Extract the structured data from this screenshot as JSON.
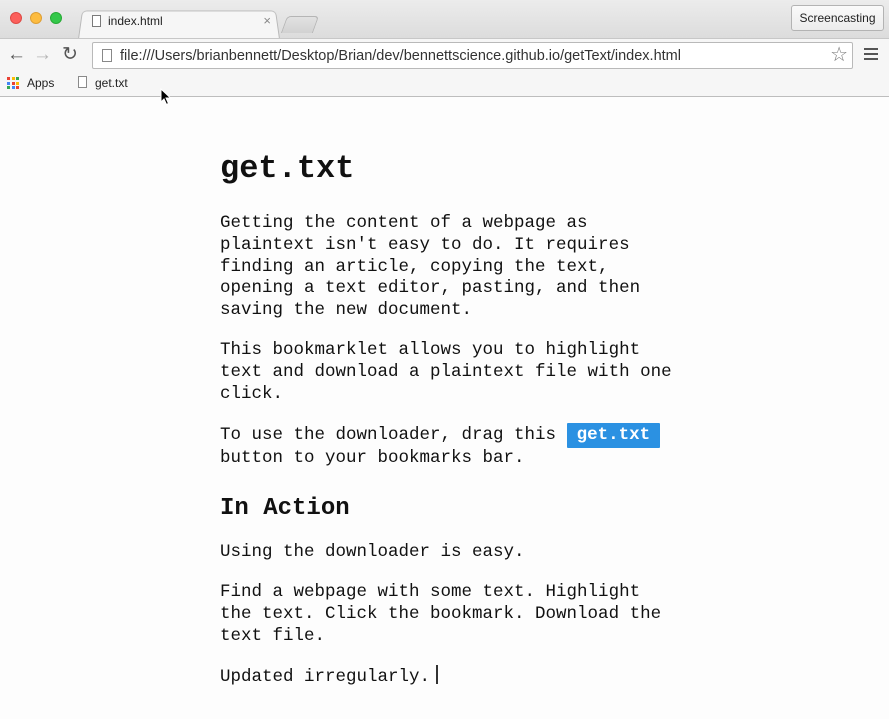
{
  "browser": {
    "tab": {
      "title": "index.html",
      "close_glyph": "×"
    },
    "extension_button": "Screencasting",
    "toolbar": {
      "back_glyph": "←",
      "forward_glyph": "→",
      "reload_glyph": "↻",
      "url": "file:///Users/brianbennett/Desktop/Brian/dev/bennettscience.github.io/getText/index.html",
      "star_glyph": "☆"
    },
    "bookmarks": [
      {
        "label": "Apps",
        "icon": "apps-grid-icon"
      },
      {
        "label": "get.txt",
        "icon": "page-icon"
      }
    ],
    "apps_colors": [
      "#e94235",
      "#fbbc04",
      "#34a853",
      "#4285f4",
      "#e94235",
      "#fbbc04",
      "#34a853",
      "#4285f4",
      "#e94235"
    ]
  },
  "page": {
    "title": "get.txt",
    "intro": [
      "Getting the content of a webpage as plaintext isn't easy to do. It requires finding an article, copying the text, opening a text editor, pasting, and then saving the new document.",
      "This bookmarklet allows you to highlight text and download a plaintext file with one click."
    ],
    "instructions_before": "To use the downloader, drag this",
    "bookmarklet_button": "get.txt",
    "instructions_after": "button to your bookmarks bar.",
    "section_title": "In Action",
    "action_text": [
      "Using the downloader is easy.",
      "Find a webpage with some text. Highlight the text. Click the bookmark. Download the text file.",
      "Updated irregularly."
    ]
  },
  "colors": {
    "button_bg": "#2b91e2",
    "button_text": "#ffffff",
    "text": "#111111"
  }
}
